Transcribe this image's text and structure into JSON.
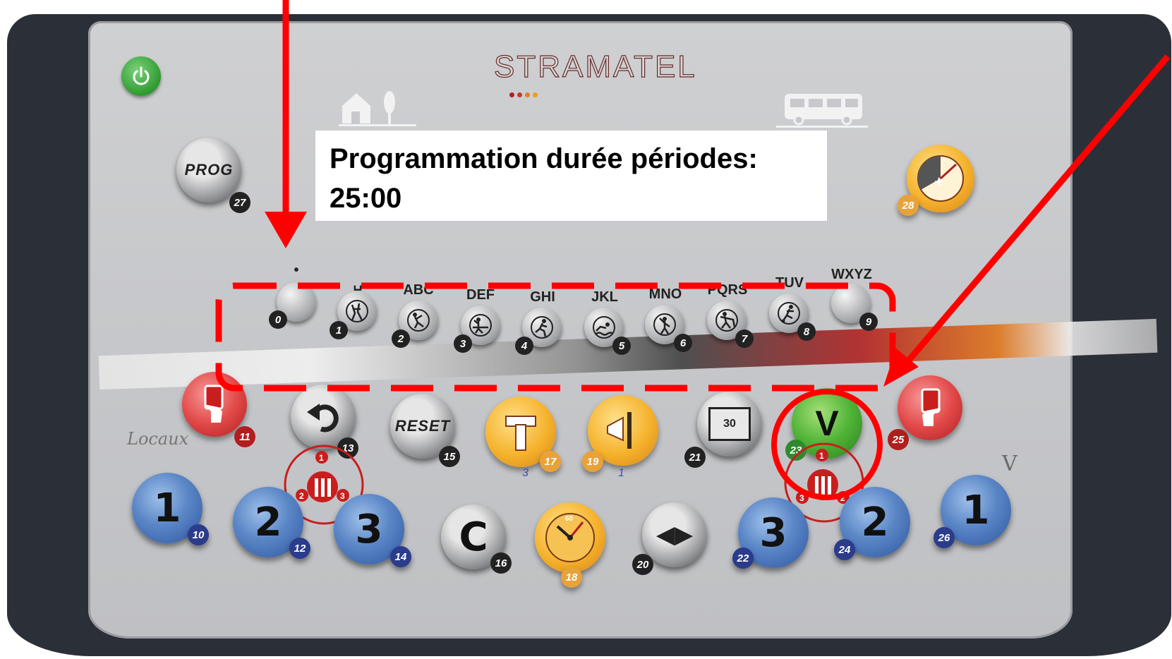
{
  "brand": {
    "name": "STRAMATEL",
    "dot_colors": [
      "#b21e1e",
      "#c0392b",
      "#e67e22",
      "#f39c12"
    ]
  },
  "callout": {
    "line1": "Programmation durée périodes:",
    "line2": "25:00"
  },
  "power_button": {
    "icon": "power-icon",
    "color": "#3aa63a"
  },
  "prog_button": {
    "label": "PROG",
    "number": "27"
  },
  "timer_button": {
    "number": "28"
  },
  "keypad": [
    {
      "key": "0",
      "letters": "•",
      "icon": "blank"
    },
    {
      "key": "1",
      "letters": "␣",
      "icon": "basketball-player-icon"
    },
    {
      "key": "2",
      "letters": "ABC",
      "icon": "handball-player-icon"
    },
    {
      "key": "3",
      "letters": "DEF",
      "icon": "volleyball-player-icon"
    },
    {
      "key": "4",
      "letters": "GHI",
      "icon": "runner-icon"
    },
    {
      "key": "5",
      "letters": "JKL",
      "icon": "swimmer-icon"
    },
    {
      "key": "6",
      "letters": "MNO",
      "icon": "gymnast-icon"
    },
    {
      "key": "7",
      "letters": "PQRS",
      "icon": "hockey-player-icon"
    },
    {
      "key": "8",
      "letters": "TUV",
      "icon": "football-player-icon"
    },
    {
      "key": "9",
      "letters": "WXYZ",
      "icon": "blank"
    }
  ],
  "middle_row": [
    {
      "name": "red-card-home",
      "number": "11"
    },
    {
      "name": "undo",
      "number": "13"
    },
    {
      "name": "reset",
      "label": "RESET",
      "number": "15"
    },
    {
      "name": "timeout-home",
      "number": "17"
    },
    {
      "name": "horn",
      "number": "19"
    },
    {
      "name": "shot-clock",
      "number": "21",
      "text": "30"
    },
    {
      "name": "validate",
      "label": "V",
      "number": "23"
    },
    {
      "name": "red-card-guest",
      "number": "25"
    }
  ],
  "bottom_row": [
    {
      "label": "1",
      "number": "10",
      "color": "blue"
    },
    {
      "label": "2",
      "number": "12",
      "color": "blue"
    },
    {
      "label": "3",
      "number": "14",
      "color": "blue"
    },
    {
      "label": "C",
      "number": "16",
      "color": "grey"
    },
    {
      "label": "",
      "number": "18",
      "color": "orange",
      "dial": "60"
    },
    {
      "label": "◀▶",
      "number": "20",
      "color": "grey"
    },
    {
      "label": "3",
      "number": "22",
      "color": "blue"
    },
    {
      "label": "2",
      "number": "24",
      "color": "blue"
    },
    {
      "label": "1",
      "number": "26",
      "color": "blue"
    }
  ],
  "foul_groups": {
    "home": [
      "1",
      "2",
      "3"
    ],
    "guest": [
      "1",
      "3",
      "2"
    ]
  },
  "handwritten": {
    "home_note": "Locaux",
    "guest_note": "V",
    "mark_17": "3",
    "mark_19": "1"
  },
  "annotation_color": "#ff0000"
}
